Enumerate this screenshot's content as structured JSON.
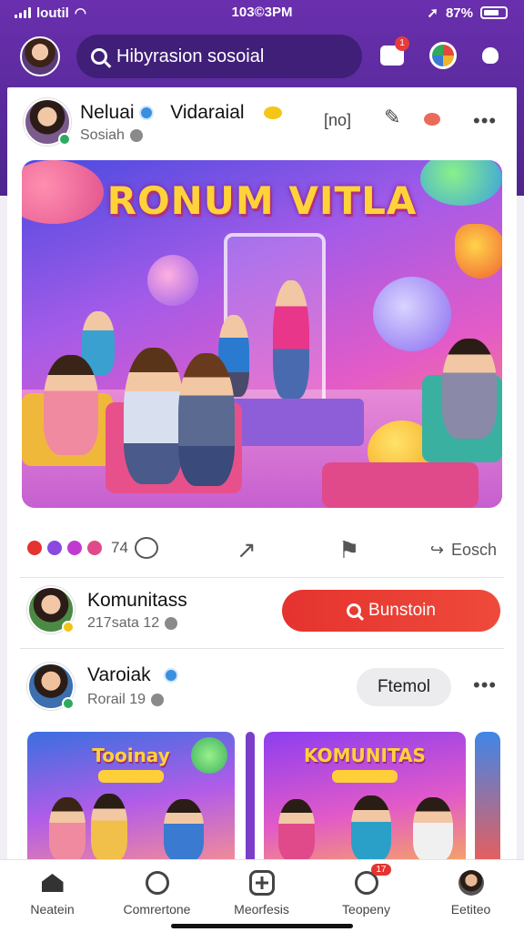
{
  "status_bar": {
    "carrier": "loutil",
    "time": "103©3PM",
    "battery": "87%"
  },
  "header": {
    "search_placeholder": "Hibyrasion sosoial",
    "inbox_badge": "1"
  },
  "post": {
    "author": "Neluai",
    "author_second": "Vidaraial",
    "subtitle": "Sosiah",
    "action_label": "[no]",
    "more": "•••",
    "hero_title": "RONUM VITLA",
    "reaction_count": "74",
    "share_label": "Eosch"
  },
  "community": {
    "name": "Komunitass",
    "meta": "217sata 12",
    "cta_label": "Bunstoin"
  },
  "friend": {
    "name": "Varoiak",
    "meta": "Rorail 19",
    "button_label": "Ftemol",
    "more": "•••"
  },
  "thumbnails": [
    {
      "title": "Tooinay"
    },
    {
      "title": "KOMUNITAS"
    }
  ],
  "bottom_nav": [
    {
      "label": "Neatein",
      "icon": "home-icon"
    },
    {
      "label": "Comrertone",
      "icon": "search-circle-icon"
    },
    {
      "label": "Meorfesis",
      "icon": "plus-icon"
    },
    {
      "label": "Teopeny",
      "icon": "chat-icon",
      "badge": "17"
    },
    {
      "label": "Eetiteo",
      "icon": "profile-avatar-icon"
    }
  ],
  "colors": {
    "brand_purple": "#5a2a9c",
    "cta_red": "#e5332f",
    "verified_blue": "#3a8fe0"
  }
}
